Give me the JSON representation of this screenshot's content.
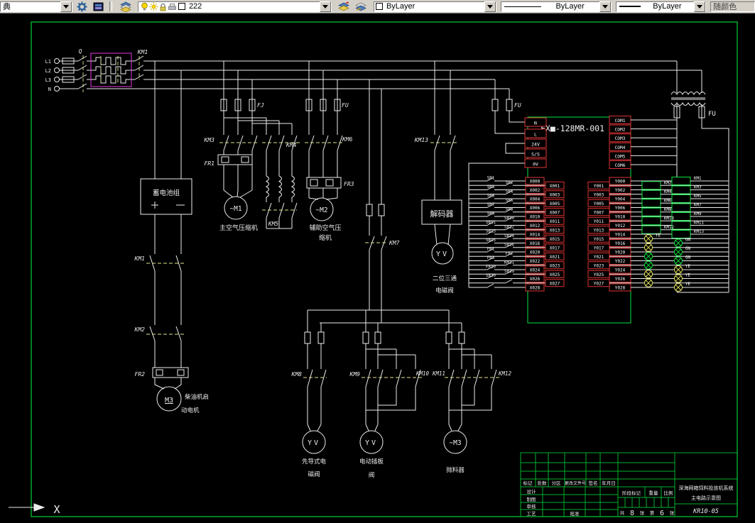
{
  "toolbar": {
    "workspace_value": "典",
    "layer_value": "222",
    "color_value": "ByLayer",
    "linetype_value": "ByLayer",
    "lineweight_value": "ByLayer",
    "plot_style_value": "随颜色"
  },
  "colors": {
    "line_white": "#ececec",
    "frame_green": "#00b22d",
    "bright_green": "#00e33c",
    "terminal_red": "#e03333",
    "breaker_magenta": "#e23ae2",
    "link_yellow": "#e3e38f",
    "lamp_yellow": "#e6e65e"
  },
  "drawing": {
    "phase_labels": [
      "L1",
      "L2",
      "L3",
      "N"
    ],
    "breaker_label": "Q",
    "main_contactor_label": "KM1",
    "battery": {
      "label": "蓄电池组",
      "plus": "+",
      "minus": "—"
    },
    "battery_branch": {
      "km1": "KM1",
      "km2": "KM2",
      "fr2": "FR2",
      "motor": "M3",
      "caption1": "柴油机启",
      "caption2": "动电机"
    },
    "compressor1": {
      "fuse_label": "FJ",
      "km3": "KM3",
      "km4": "KM4",
      "fr1": "FR1",
      "km5": "KM5",
      "motor": "~M1",
      "caption": "主空气压缩机"
    },
    "compressor2": {
      "fuse_label": "FU",
      "km6": "KM6",
      "fr3": "FR3",
      "motor": "~M2",
      "caption1": "辅助空气压",
      "caption2": "缩机"
    },
    "km7_label": "KM7",
    "decoder_branch": {
      "km13": "KM13",
      "decoder": "解码器",
      "valve": "YV",
      "caption1": "二位三通",
      "caption2": "电磁阀"
    },
    "pilot_valve_branch": {
      "km8": "KM8",
      "valve": "YV",
      "caption1": "先导式电",
      "caption2": "磁阀"
    },
    "gate_valve_branch": {
      "km9": "KM9",
      "km10": "KM10",
      "valve": "YV",
      "caption1": "电动插板",
      "caption2": "阀"
    },
    "thrower_branch": {
      "km11": "KM11",
      "km12": "KM12",
      "motor": "~M3",
      "caption": "抛料器"
    },
    "plc_fuse_label": "FU",
    "transformer_fuse_label": "FU",
    "ucs_axis_label": "X"
  },
  "plc": {
    "title": "FX■-128MR-001",
    "power_terminals": [
      "N",
      "L",
      "24V",
      "S/S",
      "0V"
    ],
    "com_terminals": [
      "COM1",
      "COM2",
      "COM3",
      "COM4",
      "COM5",
      "COM6"
    ],
    "inputs": [
      {
        "terminal": "X000",
        "device": "SB1"
      },
      {
        "terminal": "X001",
        "device": "SB2"
      },
      {
        "terminal": "X002",
        "device": "SB3"
      },
      {
        "terminal": "X003",
        "device": "SB4"
      },
      {
        "terminal": "X004",
        "device": "SB5"
      },
      {
        "terminal": "X005",
        "device": "SB6"
      },
      {
        "terminal": "X006",
        "device": "SB7"
      },
      {
        "terminal": "X007",
        "device": "SB8"
      },
      {
        "terminal": "X010",
        "device": "SB9"
      },
      {
        "terminal": "X011",
        "device": "SB10"
      },
      {
        "terminal": "X012",
        "device": "SB11"
      },
      {
        "terminal": "X013",
        "device": "SB12"
      },
      {
        "terminal": "X014",
        "device": "SB13"
      },
      {
        "terminal": "X015",
        "device": "SB14"
      },
      {
        "terminal": "X016",
        "device": "SB15"
      },
      {
        "terminal": "X017",
        "device": "SB16"
      },
      {
        "terminal": "X020",
        "device": "FR1"
      },
      {
        "terminal": "X021",
        "device": "FR2"
      },
      {
        "terminal": "X022",
        "device": "FR3"
      },
      {
        "terminal": "X023",
        "device": "KM11"
      },
      {
        "terminal": "X024",
        "device": "FR10"
      },
      {
        "terminal": "X025",
        "device": "SB19"
      },
      {
        "terminal": "X026",
        "device": "SB20"
      },
      {
        "terminal": "X027",
        "device": ""
      },
      {
        "terminal": "X028",
        "device": ""
      }
    ],
    "outputs": [
      {
        "terminal": "Y000",
        "kind": "coil",
        "device": "KM1"
      },
      {
        "terminal": "Y001",
        "kind": "coil",
        "device": "KM2"
      },
      {
        "terminal": "Y002",
        "kind": "coil",
        "device": "KM3"
      },
      {
        "terminal": "Y003",
        "kind": "coil",
        "device": "KM4"
      },
      {
        "terminal": "Y004",
        "kind": "coil",
        "device": "KM5"
      },
      {
        "terminal": "Y005",
        "kind": "coil",
        "device": "KM6"
      },
      {
        "terminal": "Y006",
        "kind": "coil",
        "device": "KM7"
      },
      {
        "terminal": "Y007",
        "kind": "coil",
        "device": "KM8"
      },
      {
        "terminal": "Y010",
        "kind": "coil",
        "device": "KM9"
      },
      {
        "terminal": "Y011",
        "kind": "coil",
        "device": "KM10"
      },
      {
        "terminal": "Y012",
        "kind": "coil",
        "device": "KM11"
      },
      {
        "terminal": "Y013",
        "kind": "coil",
        "device": "KM12"
      },
      {
        "terminal": "Y014",
        "kind": "coil",
        "device": "KM13"
      },
      {
        "terminal": "Y015",
        "kind": "lamp",
        "color": "yellow",
        "device": "YE"
      },
      {
        "terminal": "Y016",
        "kind": "lamp",
        "color": "green",
        "device": "GN"
      },
      {
        "terminal": "Y017",
        "kind": "lamp",
        "color": "yellow",
        "device": ""
      },
      {
        "terminal": "Y020",
        "kind": "lamp",
        "color": "green",
        "device": "GN"
      },
      {
        "terminal": "Y021",
        "kind": "lamp",
        "color": "green",
        "device": ""
      },
      {
        "terminal": "Y022",
        "kind": "lamp",
        "color": "green",
        "device": "GN"
      },
      {
        "terminal": "Y023",
        "kind": "lamp",
        "color": "green",
        "device": ""
      },
      {
        "terminal": "Y024",
        "kind": "lamp",
        "color": "yellow",
        "device": "YE"
      },
      {
        "terminal": "Y025",
        "kind": "lamp",
        "color": "yellow",
        "device": ""
      },
      {
        "terminal": "Y026",
        "kind": "lamp",
        "color": "yellow",
        "device": "YE"
      },
      {
        "terminal": "Y027",
        "kind": "lamp",
        "color": "yellow",
        "device": ""
      },
      {
        "terminal": "Y028",
        "kind": "lamp",
        "color": "yellow",
        "device": "YE"
      }
    ]
  },
  "titleblock": {
    "revision_headers": [
      "标记",
      "处数",
      "分区",
      "更改文件号",
      "签名",
      "年月日"
    ],
    "role_labels": [
      "设计",
      "制图",
      "审核",
      "工艺"
    ],
    "approve_label": "批准",
    "stage_label": "阶段标记",
    "weight_label": "重量",
    "scale_label": "比例",
    "sheets_total_prefix": "共",
    "sheets_total": "8",
    "sheets_total_suffix": "张",
    "sheet_no_prefix": "第",
    "sheet_no": "6",
    "sheet_no_suffix": "张",
    "project_title_line1": "深海网箱饲料投放机系统",
    "project_title_line2": "主电路示意图",
    "drawing_no": "KR10-05"
  }
}
